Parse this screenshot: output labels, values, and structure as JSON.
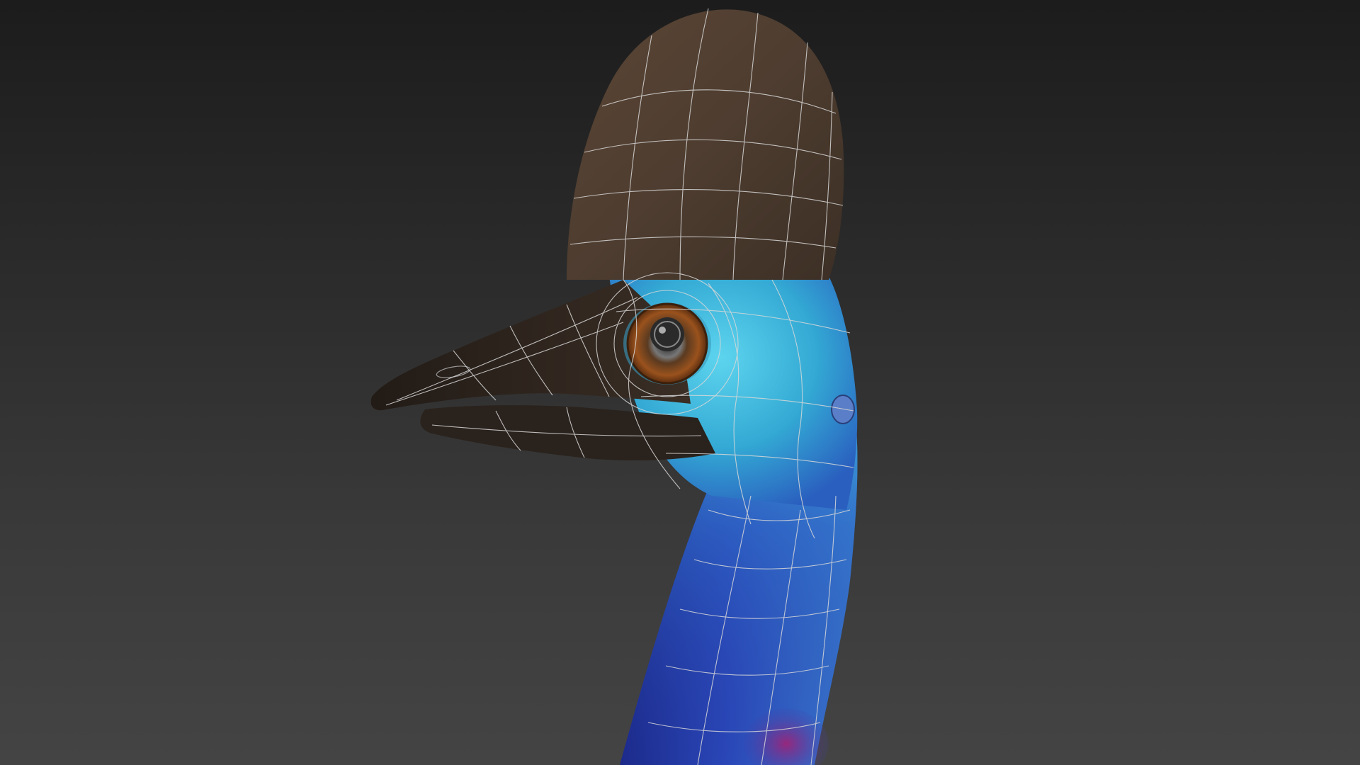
{
  "viewport": {
    "background_top": "#1c1c1c",
    "background_bottom": "#444444"
  },
  "model": {
    "subject": "cassowary-head",
    "casque_color": "#4e3d30",
    "beak_color": "#2b221c",
    "face_color": "#3fc3df",
    "neck_color": "#2a47b8",
    "wireframe_color": "#d8d8d8",
    "iris_color": "#8a4a1c"
  }
}
